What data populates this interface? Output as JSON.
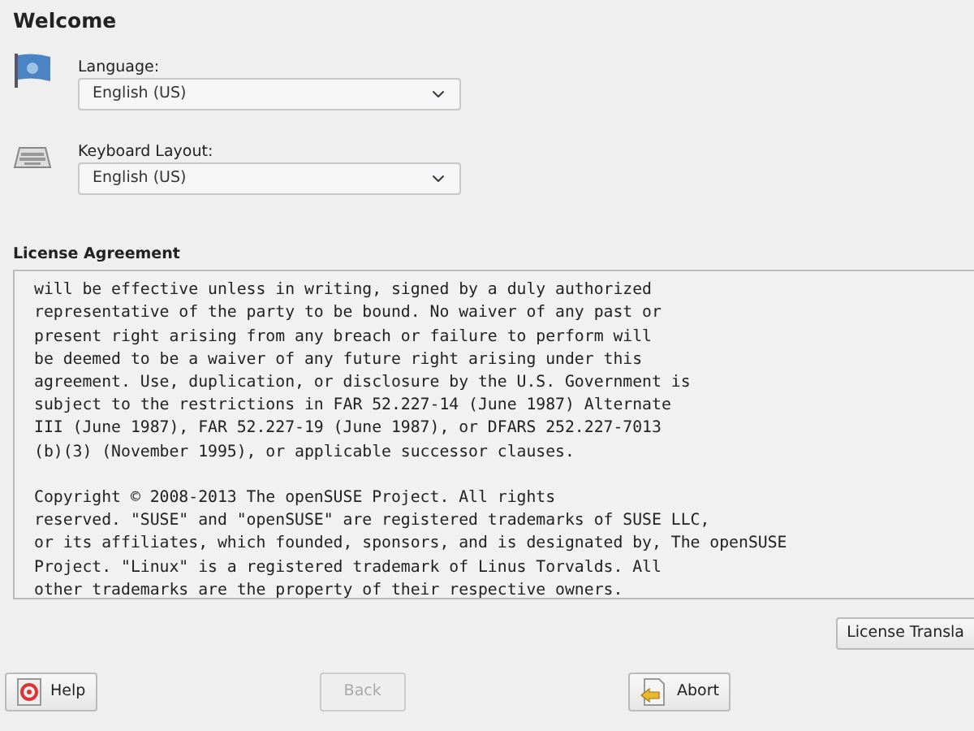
{
  "title": "Welcome",
  "fields": [
    {
      "kind": "language",
      "label": "Language:",
      "value": "English (US)"
    },
    {
      "kind": "keyboard",
      "label": "Keyboard Layout:",
      "value": "English (US)"
    }
  ],
  "license": {
    "heading": "License Agreement",
    "paragraphs": [
      [
        "will be effective unless in writing, signed by a duly authorized",
        "representative of the party to be bound. No waiver of any past or",
        "present right arising from any breach or failure to perform will",
        "be deemed to be a waiver of any future right arising under this",
        "agreement. Use, duplication, or disclosure by the U.S. Government is",
        "subject to the restrictions in FAR 52.227-14 (June 1987) Alternate",
        "III (June 1987), FAR 52.227-19 (June 1987), or DFARS 252.227-7013",
        "(b)(3) (November 1995), or applicable successor clauses."
      ],
      [
        "Copyright © 2008-2013 The openSUSE Project. All rights",
        "reserved. \"SUSE\" and \"openSUSE\" are registered trademarks of SUSE LLC,",
        "or its affiliates, which founded, sponsors, and is designated by, The openSUSE",
        "Project. \"Linux\" is a registered trademark of Linus Torvalds. All",
        "other trademarks are the property of their respective owners."
      ]
    ],
    "translations_button": "License Transla"
  },
  "buttons": [
    {
      "kind": "help",
      "label": "Help",
      "disabled": false
    },
    {
      "kind": "back",
      "label": "Back",
      "disabled": true
    },
    {
      "kind": "abort",
      "label": "Abort",
      "disabled": false
    }
  ]
}
